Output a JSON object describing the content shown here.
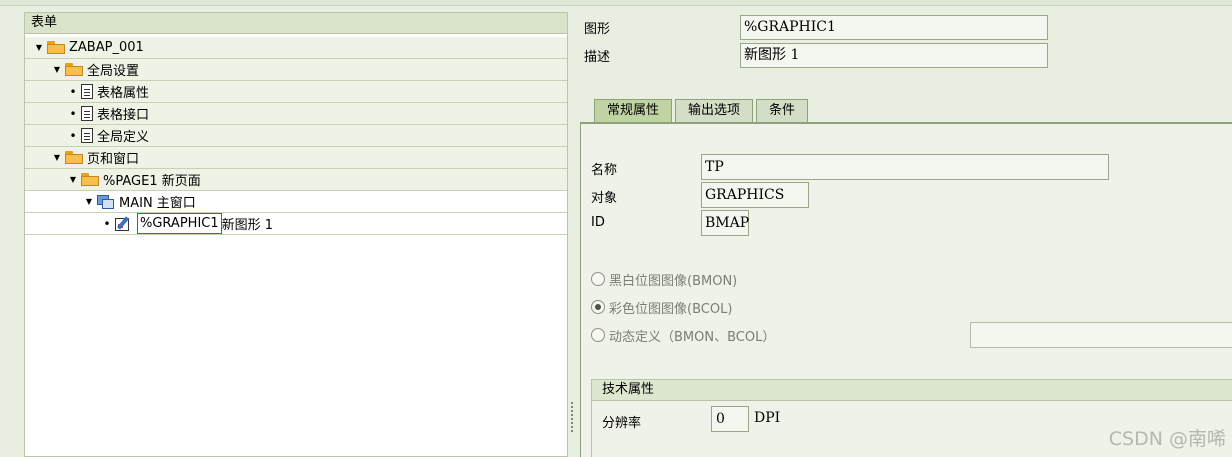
{
  "tree": {
    "header": "表单",
    "nodes": [
      {
        "label": "ZABAP_001",
        "suffix": ""
      },
      {
        "label": "全局设置",
        "suffix": ""
      },
      {
        "label": "表格属性",
        "suffix": ""
      },
      {
        "label": "表格接口",
        "suffix": ""
      },
      {
        "label": "全局定义",
        "suffix": ""
      },
      {
        "label": "页和窗口",
        "suffix": ""
      },
      {
        "label": "%PAGE1 新页面",
        "suffix": ""
      },
      {
        "label": "MAIN 主窗口",
        "suffix": ""
      },
      {
        "label": "%GRAPHIC1",
        "suffix": "新图形 1"
      }
    ]
  },
  "header": {
    "graphic_label": "图形",
    "graphic_value": "%GRAPHIC1",
    "desc_label": "描述",
    "desc_value": "新图形 1"
  },
  "tabs": [
    "常规属性",
    "输出选项",
    "条件"
  ],
  "general": {
    "name_label": "名称",
    "name_value": "TP",
    "object_label": "对象",
    "object_value": "GRAPHICS",
    "id_label": "ID",
    "id_value": "BMAP",
    "radios": [
      {
        "label": "黑白位图图像(BMON)",
        "checked": false
      },
      {
        "label": "彩色位图图像(BCOL)",
        "checked": true
      },
      {
        "label": "动态定义（BMON、BCOL）",
        "checked": false
      }
    ],
    "tech_group_title": "技术属性",
    "resolution_label": "分辨率",
    "resolution_value": "0",
    "resolution_unit": "DPI"
  },
  "watermark": "CSDN @南唏"
}
